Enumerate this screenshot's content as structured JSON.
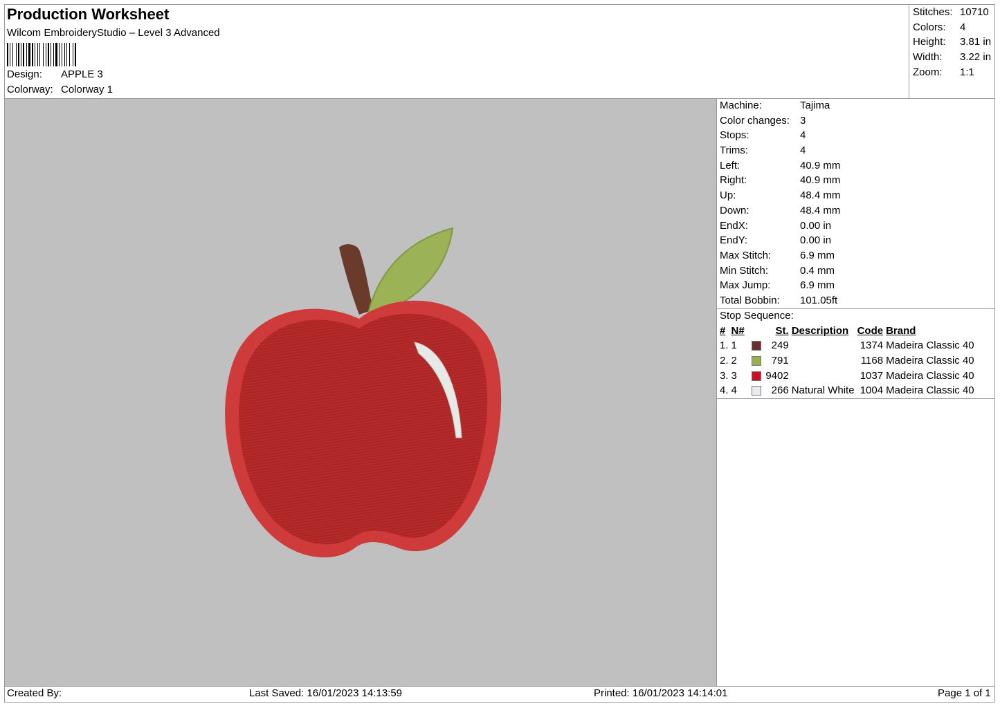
{
  "header": {
    "title": "Production Worksheet",
    "software": "Wilcom EmbroideryStudio – Level 3 Advanced",
    "design_label": "Design:",
    "design_value": "APPLE 3",
    "colorway_label": "Colorway:",
    "colorway_value": "Colorway 1"
  },
  "summary": [
    {
      "label": "Stitches:",
      "value": "10710"
    },
    {
      "label": "Colors:",
      "value": "4"
    },
    {
      "label": "Height:",
      "value": "3.81 in"
    },
    {
      "label": "Width:",
      "value": "3.22 in"
    },
    {
      "label": "Zoom:",
      "value": "1:1"
    }
  ],
  "machine_info": [
    {
      "label": "Machine:",
      "value": "Tajima"
    },
    {
      "label": "Color changes:",
      "value": "3"
    },
    {
      "label": "Stops:",
      "value": "4"
    },
    {
      "label": "Trims:",
      "value": "4"
    },
    {
      "label": "Left:",
      "value": "40.9 mm"
    },
    {
      "label": "Right:",
      "value": "40.9 mm"
    },
    {
      "label": "Up:",
      "value": "48.4 mm"
    },
    {
      "label": "Down:",
      "value": "48.4 mm"
    },
    {
      "label": "EndX:",
      "value": "0.00 in"
    },
    {
      "label": "EndY:",
      "value": "0.00 in"
    },
    {
      "label": "Max Stitch:",
      "value": "6.9 mm"
    },
    {
      "label": "Min Stitch:",
      "value": "0.4 mm"
    },
    {
      "label": "Max Jump:",
      "value": "6.9 mm"
    },
    {
      "label": "Total Bobbin:",
      "value": "101.05ft"
    }
  ],
  "stop_sequence": {
    "title": "Stop Sequence:",
    "columns": [
      "#",
      "N#",
      "St.",
      "Description",
      "Code",
      "Brand"
    ],
    "rows": [
      {
        "idx": "1.",
        "n": "1",
        "color": "#6b2f2f",
        "st": "249",
        "desc": "",
        "code": "1374",
        "brand": "Madeira Classic 40"
      },
      {
        "idx": "2.",
        "n": "2",
        "color": "#9ab04a",
        "st": "791",
        "desc": "",
        "code": "1168",
        "brand": "Madeira Classic 40"
      },
      {
        "idx": "3.",
        "n": "3",
        "color": "#d01020",
        "st": "9402",
        "desc": "",
        "code": "1037",
        "brand": "Madeira Classic 40"
      },
      {
        "idx": "4.",
        "n": "4",
        "color": "#e8eaf0",
        "st": "266",
        "desc": "Natural White",
        "code": "1004",
        "brand": "Madeira Classic 40"
      }
    ]
  },
  "footer": {
    "created_by": "Created By:",
    "last_saved": "Last Saved: 16/01/2023 14:13:59",
    "printed": "Printed: 16/01/2023 14:14:01",
    "page": "Page 1 of 1"
  },
  "colors": {
    "canvas_bg": "#c0c0c0",
    "apple_red": "#b52a2a",
    "apple_outline": "#cf3a3a",
    "stem": "#6a3a2a",
    "leaf": "#9bb257",
    "highlight": "#e6e9e6"
  }
}
